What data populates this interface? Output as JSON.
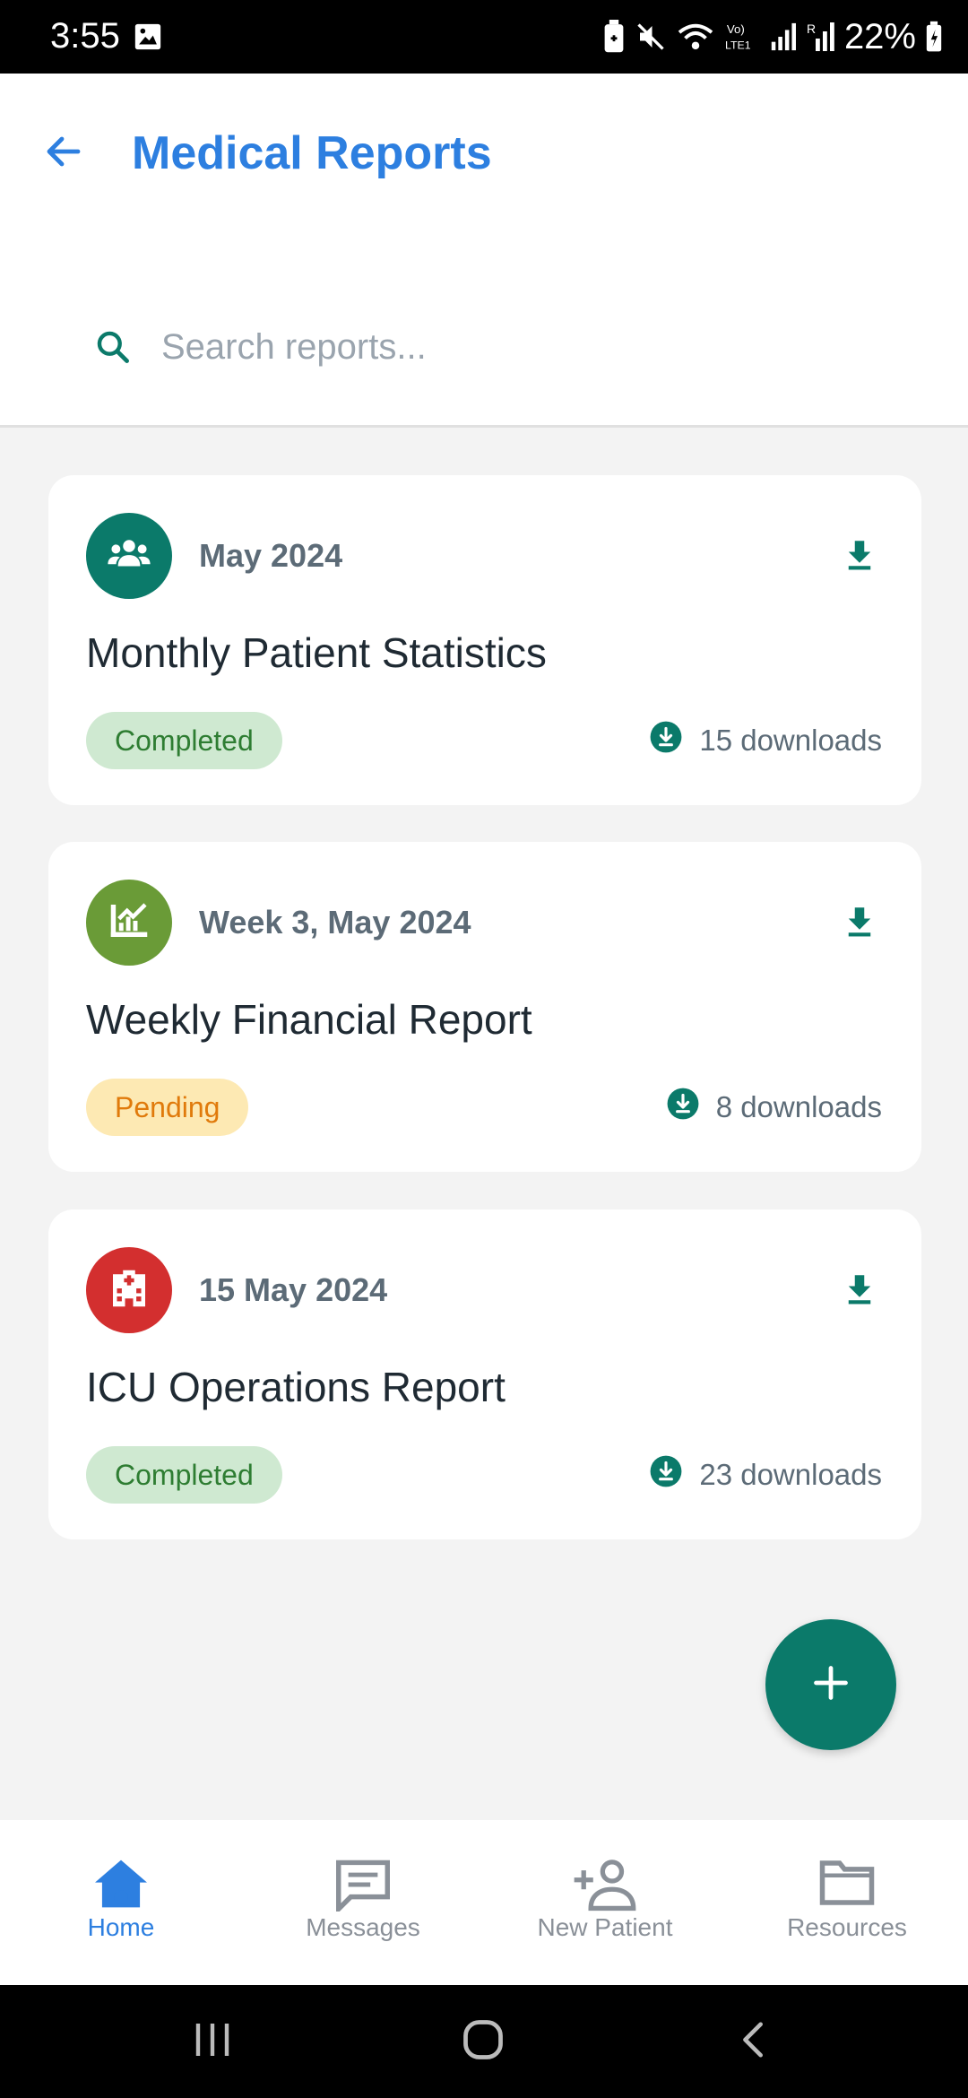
{
  "status_bar": {
    "time": "3:55",
    "battery": "22%",
    "icons": [
      "gallery-icon",
      "battery-saver-icon",
      "mute-icon",
      "wifi-icon",
      "volte-icon",
      "signal-icon",
      "roaming-signal-icon",
      "battery-charging-icon"
    ]
  },
  "header": {
    "title": "Medical Reports",
    "back_icon": "arrow-left-icon"
  },
  "search": {
    "placeholder": "Search reports...",
    "value": ""
  },
  "reports": [
    {
      "date": "May 2024",
      "title": "Monthly Patient Statistics",
      "status": "Completed",
      "downloads": "15 downloads",
      "icon": "people-group-icon",
      "icon_color": "#0b7a6a"
    },
    {
      "date": "Week 3, May 2024",
      "title": "Weekly Financial Report",
      "status": "Pending",
      "downloads": "8 downloads",
      "icon": "chart-trend-icon",
      "icon_color": "#6a9b37"
    },
    {
      "date": "15 May 2024",
      "title": "ICU Operations Report",
      "status": "Completed",
      "downloads": "23 downloads",
      "icon": "hospital-icon",
      "icon_color": "#d32f2f"
    }
  ],
  "fab": {
    "icon": "plus-icon"
  },
  "bottom_nav": {
    "items": [
      {
        "label": "Home",
        "icon": "home-icon",
        "active": true
      },
      {
        "label": "Messages",
        "icon": "message-icon",
        "active": false
      },
      {
        "label": "New Patient",
        "icon": "add-person-icon",
        "active": false
      },
      {
        "label": "Resources",
        "icon": "folder-icon",
        "active": false
      }
    ]
  },
  "colors": {
    "accent": "#2d7fe0",
    "teal": "#0b7a6a",
    "completed_bg": "#cfe9d1",
    "completed_text": "#2e7d32",
    "pending_bg": "#fde9b3",
    "pending_text": "#e07a0b"
  }
}
